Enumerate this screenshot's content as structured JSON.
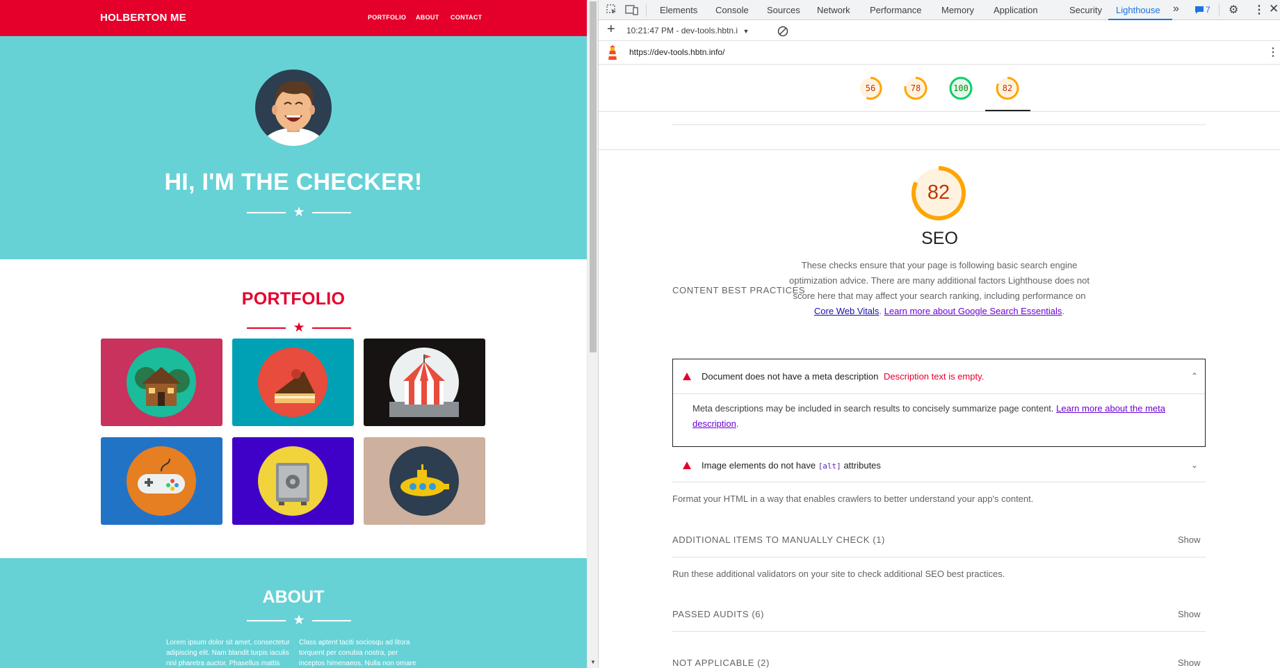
{
  "site": {
    "brand": "HOLBERTON ME",
    "nav": [
      "PORTFOLIO",
      "ABOUT",
      "CONTACT"
    ],
    "hero_title": "HI, I'M THE CHECKER!",
    "portfolio_title": "PORTFOLIO",
    "portfolio_items": [
      {
        "icon": "cabin-icon",
        "bg": "#c8325d"
      },
      {
        "icon": "cake-icon",
        "bg": "#00a1b4"
      },
      {
        "icon": "circus-tent-icon",
        "bg": "#171313"
      },
      {
        "icon": "game-controller-icon",
        "bg": "#2173c6"
      },
      {
        "icon": "safe-icon",
        "bg": "#3f00c8"
      },
      {
        "icon": "submarine-icon",
        "bg": "#cdb09e"
      }
    ],
    "about_title": "ABOUT",
    "about_col1": "Lorem ipsum dolor sit amet, consectetur adipiscing elit. Nam blandit turpis iaculis nisl pharetra auctor. Phasellus mattis",
    "about_col2": "Class aptent taciti sociosqu ad litora torquent per conubia nostra, per inceptos himenaeos. Nulla non ornare",
    "colors": {
      "primary": "#e4002b",
      "teal": "#66d2d6"
    }
  },
  "devtools": {
    "tabs": [
      "Elements",
      "Console",
      "Sources",
      "Network",
      "Performance",
      "Memory",
      "Application",
      "Security",
      "Lighthouse"
    ],
    "active_tab": "Lighthouse",
    "issues_count": "7",
    "report_select": "10:21:47 PM - dev-tools.hbtn.i",
    "url": "https://dev-tools.hbtn.info/",
    "scores": [
      {
        "value": "56",
        "color": "#ffa400"
      },
      {
        "value": "78",
        "color": "#ffa400"
      },
      {
        "value": "100",
        "color": "#0cce6b"
      },
      {
        "value": "82",
        "color": "#ffa400"
      }
    ],
    "seo": {
      "score": "82",
      "score_fraction": 0.82,
      "title": "SEO",
      "description": "These checks ensure that your page is following basic search engine optimization advice. There are many additional factors Lighthouse does not score here that may affect your search ranking, including performance on",
      "link1": "Core Web Vitals",
      "sep": ". ",
      "link2": "Learn more about Google Search Essentials",
      "end": "."
    },
    "content_best_practices": "CONTENT BEST PRACTICES",
    "audit1": {
      "title": "Document does not have a meta description",
      "error": "Description text is empty.",
      "body": "Meta descriptions may be included in search results to concisely summarize page content.",
      "link": "Learn more about the meta description",
      "end": "."
    },
    "audit2": {
      "pre": "Image elements do not have",
      "code": "[alt]",
      "post": "attributes"
    },
    "format_note": "Format your HTML in a way that enables crawlers to better understand your app's content.",
    "additional_items": "ADDITIONAL ITEMS TO MANUALLY CHECK",
    "additional_count": "(1)",
    "run_note": "Run these additional validators on your site to check additional SEO best practices.",
    "passed_audits": "PASSED AUDITS",
    "passed_count": "(6)",
    "not_applicable": "NOT APPLICABLE",
    "na_count": "(2)",
    "show_label": "Show"
  }
}
